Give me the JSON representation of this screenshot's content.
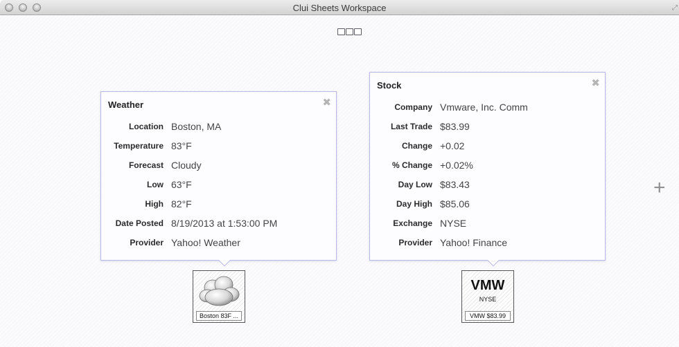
{
  "window": {
    "title": "Clui Sheets Workspace"
  },
  "weather_card": {
    "title": "Weather",
    "rows": [
      {
        "label": "Location",
        "value": "Boston, MA"
      },
      {
        "label": "Temperature",
        "value": "83°F"
      },
      {
        "label": "Forecast",
        "value": "Cloudy"
      },
      {
        "label": "Low",
        "value": "63°F"
      },
      {
        "label": "High",
        "value": "82°F"
      },
      {
        "label": "Date Posted",
        "value": "8/19/2013 at 1:53:00 PM"
      },
      {
        "label": "Provider",
        "value": "Yahoo! Weather"
      }
    ],
    "tile_caption": "Boston 83F ...",
    "tile_icon": "cloud-icon"
  },
  "stock_card": {
    "title": "Stock",
    "rows": [
      {
        "label": "Company",
        "value": "Vmware, Inc. Comm"
      },
      {
        "label": "Last Trade",
        "value": "$83.99"
      },
      {
        "label": "Change",
        "value": "+0.02"
      },
      {
        "label": "% Change",
        "value": "+0.02%"
      },
      {
        "label": "Day Low",
        "value": "$83.43"
      },
      {
        "label": "Day High",
        "value": "$85.06"
      },
      {
        "label": "Exchange",
        "value": "NYSE"
      },
      {
        "label": "Provider",
        "value": "Yahoo! Finance"
      }
    ],
    "tile_symbol": "VMW",
    "tile_exchange": "NYSE",
    "tile_caption": "VMW $83.99"
  },
  "icons": {
    "close": "close-icon",
    "add": "add-icon",
    "page_indicator": "page-dots"
  },
  "colors": {
    "card_border": "#b9b9e6",
    "background": "#fbfbfd"
  }
}
